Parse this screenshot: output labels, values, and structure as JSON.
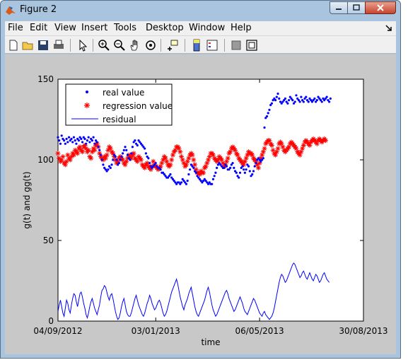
{
  "window": {
    "title": "Figure 2",
    "app_icon": "matlab-logo-icon"
  },
  "menu": [
    "File",
    "Edit",
    "View",
    "Insert",
    "Tools",
    "Desktop",
    "Window",
    "Help"
  ],
  "menu_right_icon": "dock-arrow-icon",
  "toolbar": [
    "new-figure-icon",
    "open-file-icon",
    "save-icon",
    "print-icon",
    "arrow-pointer-icon",
    "zoom-in-icon",
    "zoom-out-icon",
    "pan-hand-icon",
    "rotate-3d-icon",
    "data-cursor-icon",
    "colorbar-icon",
    "legend-icon",
    "hide-plot-tools-icon",
    "show-plot-tools-icon"
  ],
  "colors": {
    "real": "#0000ff",
    "regression": "#ff0000",
    "residual": "#0000ff"
  },
  "chart_data": {
    "type": "line",
    "xlabel": "time",
    "ylabel": "g(t) and gg(t)",
    "ylim": [
      0,
      150
    ],
    "yticks": [
      0,
      50,
      100,
      150
    ],
    "xtick_labels": [
      "04/09/2012",
      "03/01/2013",
      "06/05/2013",
      "30/08/2013"
    ],
    "x_index_range": [
      0,
      250
    ],
    "xtick_positions": [
      0,
      80,
      165,
      250
    ],
    "legend_position": "top-left",
    "series": [
      {
        "name": "real value",
        "style": "markers",
        "values": [
          114,
          112,
          110,
          115,
          113,
          112,
          110,
          113,
          111,
          114,
          112,
          113,
          111,
          114,
          112,
          110,
          113,
          112,
          114,
          113,
          111,
          114,
          113,
          110,
          112,
          114,
          111,
          113,
          112,
          114,
          110,
          112,
          111,
          108,
          106,
          103,
          100,
          97,
          95,
          94,
          93,
          94,
          96,
          95,
          97,
          100,
          103,
          102,
          100,
          97,
          98,
          100,
          102,
          104,
          106,
          108,
          106,
          103,
          101,
          100,
          104,
          108,
          111,
          112,
          110,
          109,
          112,
          111,
          110,
          109,
          108,
          107,
          104,
          102,
          101,
          98,
          96,
          95,
          96,
          97,
          98,
          96,
          95,
          95,
          94,
          92,
          92,
          91,
          90,
          89,
          89,
          90,
          91,
          89,
          88,
          87,
          86,
          85,
          86,
          86,
          85,
          86,
          88,
          87,
          86,
          85,
          87,
          91,
          94,
          97,
          96,
          95,
          93,
          92,
          90,
          89,
          88,
          87,
          86,
          87,
          88,
          87,
          86,
          85,
          86,
          85,
          85,
          88,
          90,
          92,
          95,
          97,
          98,
          97,
          96,
          95,
          95,
          97,
          96,
          94,
          94,
          95,
          97,
          98,
          95,
          93,
          92,
          90,
          89,
          92,
          95,
          96,
          94,
          92,
          94,
          97,
          96,
          93,
          90,
          91,
          93,
          96,
          98,
          100,
          101,
          100,
          99,
          100,
          101,
          120,
          126,
          127,
          129,
          131,
          134,
          135,
          137,
          138,
          137,
          139,
          141,
          138,
          136,
          135,
          136,
          137,
          138,
          136,
          135,
          137,
          139,
          138,
          137,
          135,
          136,
          140,
          138,
          137,
          136,
          139,
          137,
          136,
          138,
          139,
          137,
          136,
          138,
          137,
          136,
          137,
          138,
          136,
          137,
          139,
          138,
          137,
          136,
          138,
          137,
          138,
          139,
          137,
          136,
          138
        ]
      },
      {
        "name": "regression value",
        "style": "markers",
        "values": [
          104,
          101,
          99,
          100,
          102,
          98,
          97,
          99,
          103,
          101,
          100,
          102,
          104,
          103,
          106,
          105,
          104,
          107,
          108,
          106,
          105,
          108,
          109,
          107,
          105,
          106,
          102,
          101,
          105,
          107,
          106,
          109,
          110,
          108,
          104,
          102,
          101,
          100,
          102,
          101,
          103,
          106,
          108,
          107,
          105,
          104,
          102,
          100,
          98,
          99,
          101,
          102,
          101,
          100,
          98,
          97,
          99,
          101,
          103,
          102,
          101,
          103,
          104,
          101,
          100,
          99,
          102,
          101,
          100,
          97,
          96,
          95,
          97,
          98,
          96,
          95,
          94,
          96,
          99,
          97,
          96,
          95,
          94,
          95,
          96,
          98,
          100,
          102,
          101,
          99,
          97,
          96,
          97,
          100,
          103,
          105,
          106,
          108,
          108,
          107,
          105,
          102,
          100,
          98,
          96,
          97,
          99,
          101,
          103,
          104,
          103,
          100,
          97,
          94,
          92,
          92,
          91,
          93,
          92,
          92,
          95,
          96,
          98,
          100,
          102,
          104,
          104,
          103,
          101,
          100,
          99,
          100,
          102,
          101,
          100,
          98,
          96,
          97,
          99,
          101,
          104,
          105,
          107,
          108,
          107,
          106,
          104,
          103,
          101,
          100,
          99,
          98,
          97,
          99,
          101,
          103,
          105,
          104,
          104,
          103,
          101,
          100,
          99,
          97,
          95,
          98,
          101,
          103,
          105,
          107,
          110,
          111,
          112,
          112,
          110,
          109,
          106,
          104,
          103,
          105,
          107,
          110,
          111,
          110,
          108,
          106,
          105,
          106,
          107,
          108,
          110,
          111,
          110,
          109,
          108,
          107,
          105,
          104,
          103,
          105,
          107,
          109,
          111,
          112,
          111,
          110,
          109,
          111,
          112,
          113,
          112,
          111,
          110,
          112,
          113,
          112,
          111,
          112,
          113,
          112
        ]
      },
      {
        "name": "residual",
        "style": "line",
        "values": [
          6,
          10,
          13,
          9,
          5,
          3,
          8,
          13,
          11,
          7,
          5,
          10,
          14,
          17,
          16,
          12,
          9,
          13,
          17,
          18,
          15,
          11,
          8,
          4,
          2,
          5,
          9,
          12,
          14,
          11,
          8,
          6,
          4,
          7,
          10,
          15,
          19,
          20,
          22,
          21,
          18,
          15,
          13,
          16,
          17,
          14,
          10,
          6,
          3,
          1,
          2,
          5,
          9,
          12,
          14,
          10,
          6,
          4,
          3,
          3,
          5,
          8,
          11,
          14,
          16,
          13,
          10,
          8,
          6,
          4,
          3,
          5,
          8,
          11,
          13,
          16,
          14,
          11,
          9,
          7,
          8,
          10,
          12,
          13,
          11,
          8,
          5,
          3,
          4,
          6,
          9,
          12,
          15,
          18,
          20,
          22,
          24,
          26,
          23,
          19,
          15,
          12,
          9,
          7,
          10,
          12,
          14,
          17,
          19,
          21,
          17,
          13,
          9,
          6,
          4,
          3,
          5,
          7,
          9,
          11,
          13,
          16,
          19,
          21,
          18,
          14,
          10,
          7,
          5,
          3,
          4,
          6,
          8,
          10,
          12,
          14,
          16,
          18,
          19,
          17,
          14,
          12,
          10,
          8,
          6,
          7,
          9,
          11,
          13,
          15,
          13,
          11,
          8,
          6,
          5,
          4,
          6,
          8,
          10,
          12,
          14,
          13,
          11,
          9,
          7,
          5,
          4,
          3,
          5,
          6,
          4,
          3,
          2,
          1,
          2,
          3,
          5,
          8,
          12,
          16,
          20,
          24,
          27,
          29,
          28,
          26,
          24,
          25,
          27,
          29,
          31,
          33,
          35,
          36,
          35,
          33,
          31,
          29,
          27,
          28,
          30,
          31,
          29,
          27,
          26,
          28,
          30,
          28,
          26,
          25,
          27,
          29,
          28,
          26,
          24,
          25,
          27,
          29,
          30,
          28,
          26,
          25,
          24
        ]
      }
    ]
  }
}
